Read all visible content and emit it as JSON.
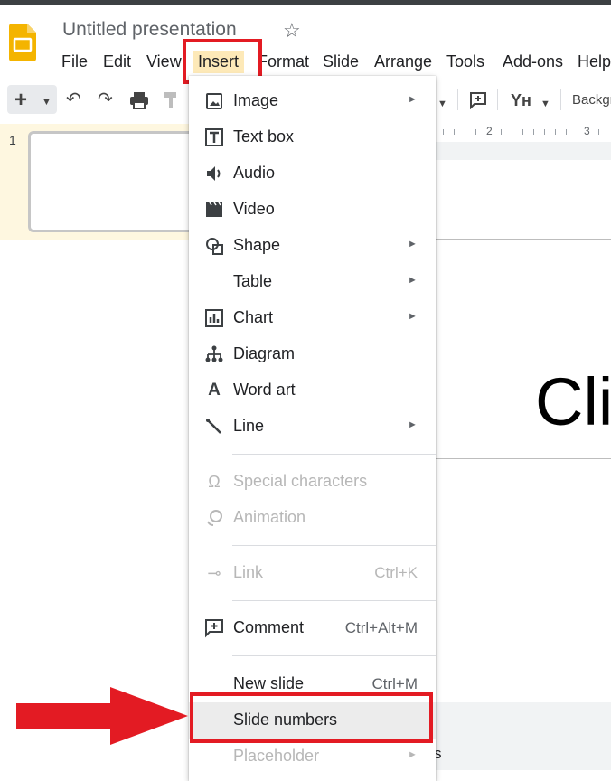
{
  "app": {
    "title": "Untitled presentation"
  },
  "menubar": {
    "items": [
      "File",
      "Edit",
      "View",
      "Insert",
      "Format",
      "Slide",
      "Arrange",
      "Tools",
      "Add-ons",
      "Help"
    ]
  },
  "toolbar": {
    "background_label": "Backgr"
  },
  "ruler": {
    "labels": [
      "2",
      "3"
    ]
  },
  "filmstrip": {
    "slide_number": "1"
  },
  "canvas": {
    "title_fragment": "Cli",
    "notes_fragment": "s"
  },
  "insert_menu": {
    "items": [
      {
        "label": "Image",
        "icon": "image-icon",
        "submenu": true
      },
      {
        "label": "Text box",
        "icon": "text-box-icon"
      },
      {
        "label": "Audio",
        "icon": "audio-icon"
      },
      {
        "label": "Video",
        "icon": "video-icon"
      },
      {
        "label": "Shape",
        "icon": "shape-icon",
        "submenu": true
      },
      {
        "label": "Table",
        "submenu": true
      },
      {
        "label": "Chart",
        "icon": "chart-icon",
        "submenu": true
      },
      {
        "label": "Diagram",
        "icon": "diagram-icon"
      },
      {
        "label": "Word art",
        "icon": "word-art-icon"
      },
      {
        "label": "Line",
        "icon": "line-icon",
        "submenu": true
      },
      {
        "label": "Special characters",
        "icon": "omega-icon",
        "disabled": true
      },
      {
        "label": "Animation",
        "icon": "animation-icon",
        "disabled": true
      },
      {
        "label": "Link",
        "icon": "link-icon",
        "shortcut": "Ctrl+K",
        "disabled": true
      },
      {
        "label": "Comment",
        "icon": "comment-icon",
        "shortcut": "Ctrl+Alt+M"
      },
      {
        "label": "New slide",
        "shortcut": "Ctrl+M"
      },
      {
        "label": "Slide numbers",
        "highlighted": true
      },
      {
        "label": "Placeholder",
        "submenu": true,
        "disabled": true
      }
    ]
  },
  "colors": {
    "annotation_red": "#e31b23",
    "menu_active_bg": "#fde9b8",
    "logo_yellow": "#f4b400"
  }
}
